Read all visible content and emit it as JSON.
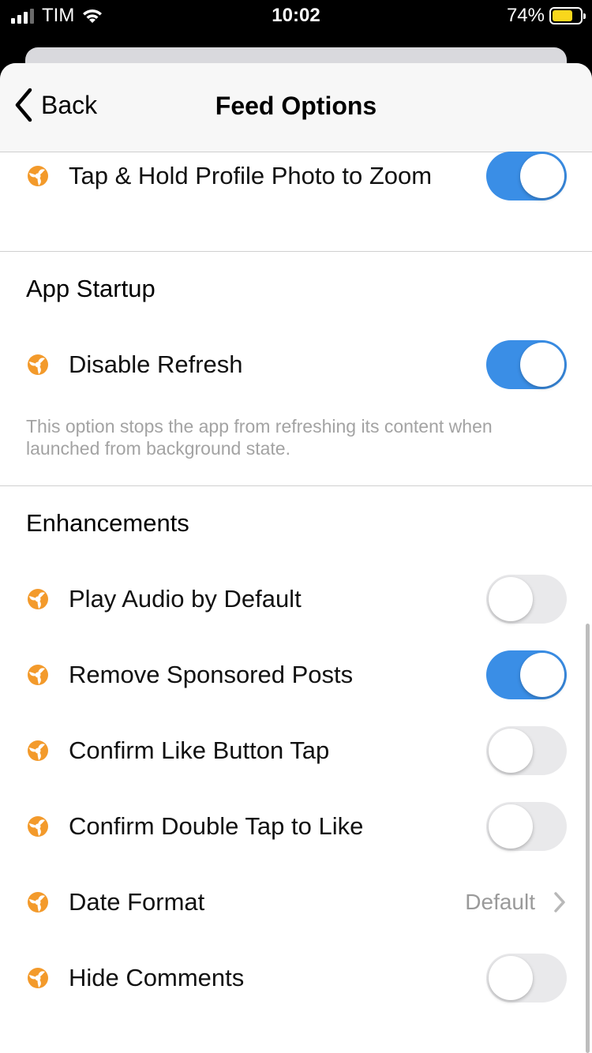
{
  "status": {
    "carrier": "TIM",
    "time": "10:02",
    "battery_pct": "74%",
    "battery_level": 0.74,
    "battery_color": "#f9d71c"
  },
  "nav": {
    "back_label": "Back",
    "title": "Feed Options"
  },
  "rows": {
    "zoom": {
      "label": "Tap & Hold Profile Photo to Zoom",
      "on": true
    },
    "disable_refresh": {
      "label": "Disable Refresh",
      "on": true
    },
    "play_audio": {
      "label": "Play Audio by Default",
      "on": false
    },
    "remove_sponsored": {
      "label": "Remove Sponsored Posts",
      "on": true
    },
    "confirm_like": {
      "label": "Confirm Like Button Tap",
      "on": false
    },
    "confirm_double_tap": {
      "label": "Confirm Double Tap to Like",
      "on": false
    },
    "date_format": {
      "label": "Date Format",
      "value": "Default"
    },
    "hide_comments": {
      "label": "Hide Comments",
      "on": false
    }
  },
  "sections": {
    "app_startup": {
      "title": "App Startup",
      "footnote": "This option stops the app from refreshing its content when launched from background state."
    },
    "enhancements": {
      "title": "Enhancements"
    }
  },
  "colors": {
    "accent": "#3a8ee6",
    "icon_orange": "#f39a2b",
    "toggle_off": "#e9e9eb"
  },
  "icons": {
    "row_icon": "orange-pinwheel-icon"
  }
}
